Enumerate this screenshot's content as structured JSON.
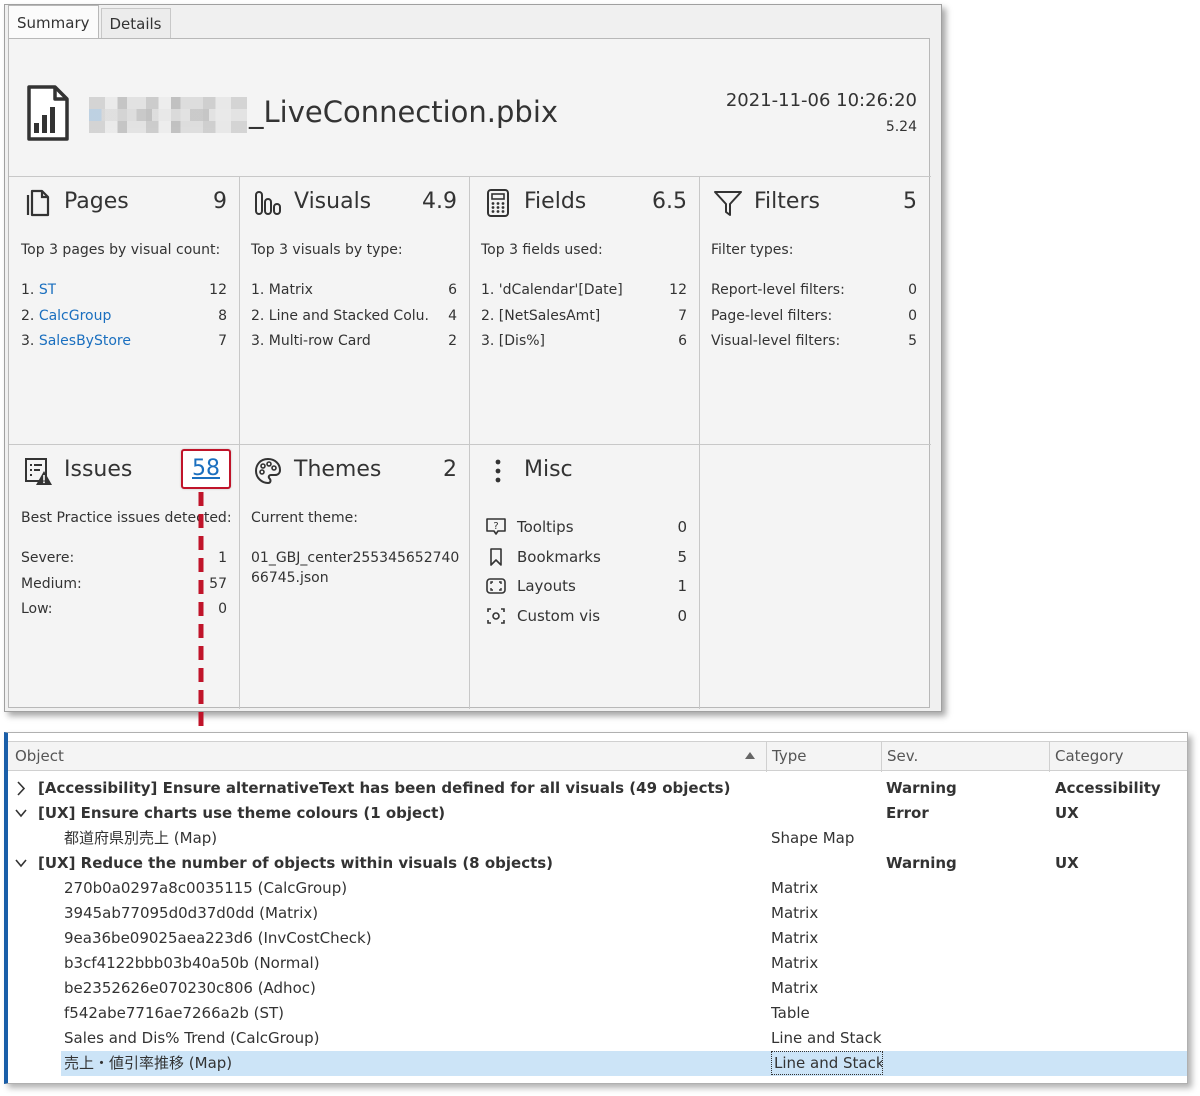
{
  "tabs": [
    {
      "label": "Summary",
      "active": true
    },
    {
      "label": "Details",
      "active": false
    }
  ],
  "file": {
    "name_suffix": "_LiveConnection.pbix",
    "datetime": "2021-11-06 10:26:20",
    "version": "5.24"
  },
  "cards": {
    "pages": {
      "title": "Pages",
      "count": "9",
      "subtitle": "Top 3 pages by visual count:",
      "rows": [
        {
          "prefix": "1. ",
          "label": "ST",
          "value": "12"
        },
        {
          "prefix": "2. ",
          "label": "CalcGroup",
          "value": "8"
        },
        {
          "prefix": "3. ",
          "label": "SalesByStore",
          "value": "7"
        }
      ]
    },
    "visuals": {
      "title": "Visuals",
      "count": "4.9",
      "subtitle": "Top 3 visuals by type:",
      "rows": [
        {
          "label": "1. Matrix",
          "value": "6"
        },
        {
          "label": "2. Line and Stacked Colu.",
          "value": "4"
        },
        {
          "label": "3. Multi-row Card",
          "value": "2"
        }
      ]
    },
    "fields": {
      "title": "Fields",
      "count": "6.5",
      "subtitle": "Top 3 fields used:",
      "rows": [
        {
          "label": "1. 'dCalendar'[Date]",
          "value": "12"
        },
        {
          "label": "2. [NetSalesAmt]",
          "value": "7"
        },
        {
          "label": "3. [Dis%]",
          "value": "6"
        }
      ]
    },
    "filters": {
      "title": "Filters",
      "count": "5",
      "subtitle": "Filter types:",
      "rows": [
        {
          "label": "Report-level filters:",
          "value": "0"
        },
        {
          "label": "Page-level filters:",
          "value": "0"
        },
        {
          "label": "Visual-level filters:",
          "value": "5"
        }
      ]
    },
    "issues": {
      "title": "Issues",
      "count": "58",
      "subtitle": "Best Practice issues detected:",
      "rows": [
        {
          "label": "Severe:",
          "value": "1"
        },
        {
          "label": "Medium:",
          "value": "57"
        },
        {
          "label": "Low:",
          "value": "0"
        }
      ]
    },
    "themes": {
      "title": "Themes",
      "count": "2",
      "subtitle": "Current theme:",
      "theme_file": "01_GBJ_center25534565274066745.json"
    },
    "misc": {
      "title": "Misc",
      "rows": [
        {
          "icon": "tooltip-icon",
          "label": "Tooltips",
          "value": "0"
        },
        {
          "icon": "bookmark-icon",
          "label": "Bookmarks",
          "value": "5"
        },
        {
          "icon": "layout-icon",
          "label": "Layouts",
          "value": "1"
        },
        {
          "icon": "custom-visual-icon",
          "label": "Custom vis",
          "value": "0"
        }
      ]
    }
  },
  "list": {
    "columns": {
      "object": "Object",
      "type": "Type",
      "severity": "Sev.",
      "category": "Category"
    },
    "rows": [
      {
        "kind": "group",
        "expanded": false,
        "object": "[Accessibility] Ensure alternativeText has been defined for all visuals (49 objects)",
        "type": "",
        "severity": "Warning",
        "category": "Accessibility"
      },
      {
        "kind": "group",
        "expanded": true,
        "object": "[UX] Ensure charts use theme colours (1 object)",
        "type": "",
        "severity": "Error",
        "category": "UX"
      },
      {
        "kind": "item",
        "object": "都道府県別売上 (Map)",
        "type": "Shape Map",
        "severity": "",
        "category": ""
      },
      {
        "kind": "group",
        "expanded": true,
        "object": "[UX] Reduce the number of objects within visuals (8 objects)",
        "type": "",
        "severity": "Warning",
        "category": "UX"
      },
      {
        "kind": "item",
        "object": "270b0a0297a8c0035115 (CalcGroup)",
        "type": "Matrix",
        "severity": "",
        "category": ""
      },
      {
        "kind": "item",
        "object": "3945ab77095d0d37d0dd (Matrix)",
        "type": "Matrix",
        "severity": "",
        "category": ""
      },
      {
        "kind": "item",
        "object": "9ea36be09025aea223d6 (InvCostCheck)",
        "type": "Matrix",
        "severity": "",
        "category": ""
      },
      {
        "kind": "item",
        "object": "b3cf4122bbb03b40a50b (Normal)",
        "type": "Matrix",
        "severity": "",
        "category": ""
      },
      {
        "kind": "item",
        "object": "be2352626e070230c806 (Adhoc)",
        "type": "Matrix",
        "severity": "",
        "category": ""
      },
      {
        "kind": "item",
        "object": "f542abe7716ae7266a2b (ST)",
        "type": "Table",
        "severity": "",
        "category": ""
      },
      {
        "kind": "item",
        "object": "Sales and Dis% Trend (CalcGroup)",
        "type": "Line and Stack...",
        "severity": "",
        "category": ""
      },
      {
        "kind": "item",
        "selected": true,
        "object": "売上・値引率推移 (Map)",
        "type": "Line and Stack...",
        "severity": "",
        "category": ""
      }
    ]
  },
  "colors": {
    "link": "#1a6fbf",
    "highlight_border": "#c0142a",
    "selection": "#cce4f7",
    "window_accent": "#1a5ea8"
  }
}
